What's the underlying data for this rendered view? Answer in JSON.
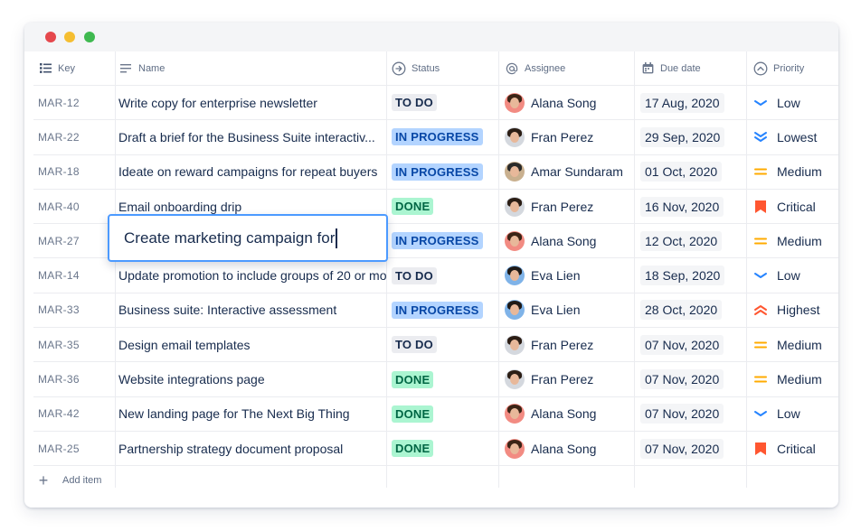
{
  "window": {
    "controls": {
      "close_color": "#E5484D",
      "minimize_color": "#F5BE31",
      "maximize_color": "#3FB950"
    }
  },
  "columns": {
    "key": {
      "label": "Key",
      "icon": "list-icon"
    },
    "name": {
      "label": "Name",
      "icon": "text-lines-icon"
    },
    "status": {
      "label": "Status",
      "icon": "arrow-circle-icon"
    },
    "assignee": {
      "label": "Assignee",
      "icon": "at-sign-icon"
    },
    "due": {
      "label": "Due date",
      "icon": "calendar-icon"
    },
    "priority": {
      "label": "Priority",
      "icon": "chevron-up-circle-icon"
    }
  },
  "status_styles": {
    "TO DO": {
      "bg": "#EBECF0",
      "fg": "#172B4D"
    },
    "IN PROGRESS": {
      "bg": "#B3D4FF",
      "fg": "#0747A6"
    },
    "DONE": {
      "bg": "#ABF5D1",
      "fg": "#006644"
    }
  },
  "priority_colors": {
    "Low": "#2684FF",
    "Lowest": "#2684FF",
    "Medium": "#FFAB00",
    "Critical": "#FF5630",
    "Highest": "#FF5630"
  },
  "rows": [
    {
      "key": "MAR-12",
      "name": "Write copy for enterprise newsletter",
      "status": "TO DO",
      "assignee": "Alana Song",
      "avatar": "alana",
      "due": "17 Aug, 2020",
      "priority": "Low"
    },
    {
      "key": "MAR-22",
      "name": "Draft a brief for the Business Suite interactiv...",
      "status": "IN PROGRESS",
      "assignee": "Fran Perez",
      "avatar": "fran",
      "due": "29 Sep, 2020",
      "priority": "Lowest"
    },
    {
      "key": "MAR-18",
      "name": "Ideate on reward campaigns for repeat buyers",
      "status": "IN PROGRESS",
      "assignee": "Amar Sundaram",
      "avatar": "amar",
      "due": "01 Oct, 2020",
      "priority": "Medium"
    },
    {
      "key": "MAR-40",
      "name": "Email onboarding drip",
      "status": "DONE",
      "assignee": "Fran Perez",
      "avatar": "fran",
      "due": "16 Nov, 2020",
      "priority": "Critical"
    },
    {
      "key": "MAR-27",
      "name": "",
      "status": "IN PROGRESS",
      "assignee": "Alana Song",
      "avatar": "alana",
      "due": "12 Oct, 2020",
      "priority": "Medium"
    },
    {
      "key": "MAR-14",
      "name": "Update promotion to include groups of 20 or mo",
      "status": "TO DO",
      "assignee": "Eva Lien",
      "avatar": "eva",
      "due": "18 Sep, 2020",
      "priority": "Low"
    },
    {
      "key": "MAR-33",
      "name": "Business suite: Interactive assessment",
      "status": "IN PROGRESS",
      "assignee": "Eva Lien",
      "avatar": "eva",
      "due": "28 Oct, 2020",
      "priority": "Highest"
    },
    {
      "key": "MAR-35",
      "name": "Design email templates",
      "status": "TO DO",
      "assignee": "Fran Perez",
      "avatar": "fran",
      "due": "07 Nov, 2020",
      "priority": "Medium"
    },
    {
      "key": "MAR-36",
      "name": "Website integrations page",
      "status": "DONE",
      "assignee": "Fran Perez",
      "avatar": "fran",
      "due": "07 Nov, 2020",
      "priority": "Medium"
    },
    {
      "key": "MAR-42",
      "name": "New landing page for The Next Big Thing",
      "status": "DONE",
      "assignee": "Alana Song",
      "avatar": "alana",
      "due": "07 Nov, 2020",
      "priority": "Low"
    },
    {
      "key": "MAR-25",
      "name": "Partnership strategy document proposal",
      "status": "DONE",
      "assignee": "Alana Song",
      "avatar": "alana",
      "due": "07 Nov, 2020",
      "priority": "Critical"
    }
  ],
  "avatars": {
    "alana": {
      "bg": "#F28B82",
      "hair": "#3B2416"
    },
    "fran": {
      "bg": "#D4D8DE",
      "hair": "#2B1D14"
    },
    "amar": {
      "bg": "#C9B08F",
      "hair": "#2A2A2A"
    },
    "eva": {
      "bg": "#7FB3E8",
      "hair": "#1F1A17"
    }
  },
  "editor": {
    "value": "Create marketing campaign for"
  },
  "add_item": {
    "label": "Add item"
  }
}
